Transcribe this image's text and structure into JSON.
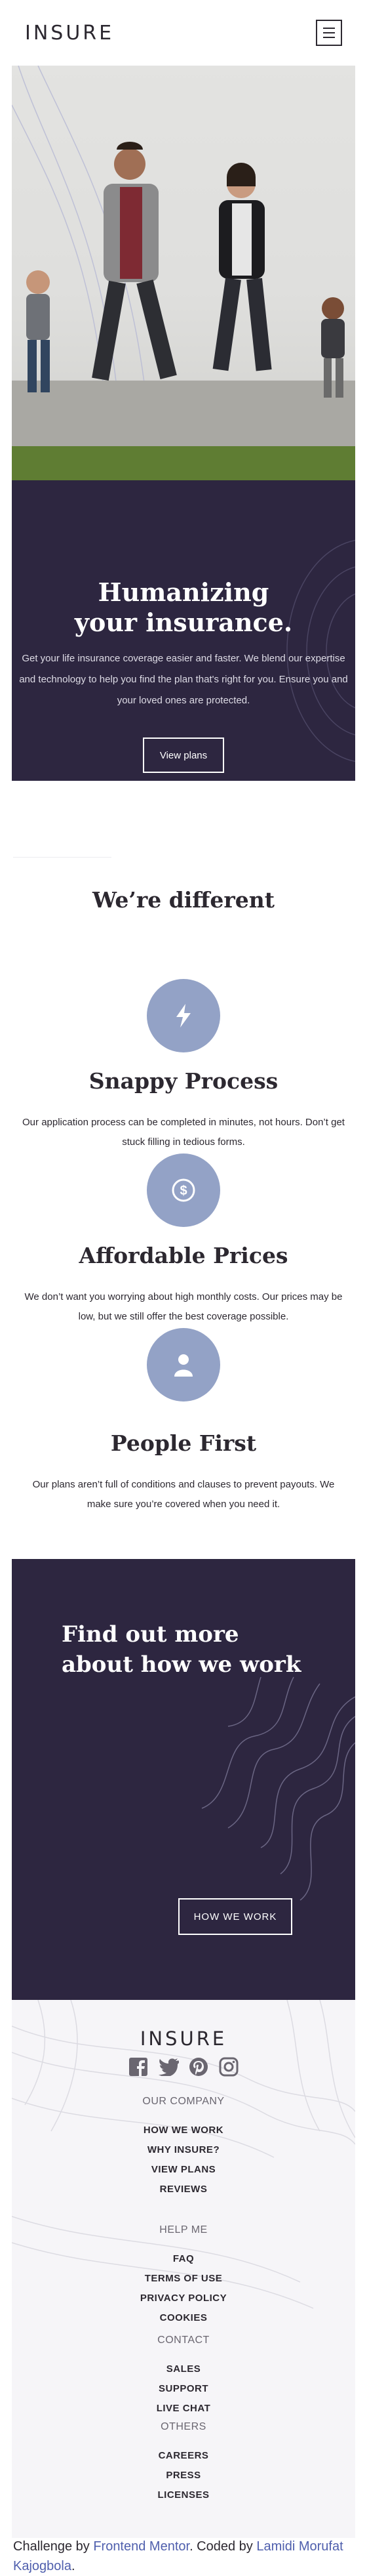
{
  "header": {
    "logo": "INSURE",
    "menu_icon": "hamburger-icon"
  },
  "hero": {
    "title_line1": "Humanizing",
    "title_line2": "your insurance.",
    "text": "Get your life insurance coverage easier and faster. We blend our expertise and technology to help you find the plan that's right for you. Ensure you and your loved ones are protected.",
    "button_label": "View plans"
  },
  "different": {
    "title": "We’re different",
    "features": [
      {
        "icon": "lightning-icon",
        "title": "Snappy Process",
        "text": "Our application process can be completed in minutes, not hours. Don’t get stuck filling in tedious forms."
      },
      {
        "icon": "dollar-coin-icon",
        "title": "Affordable Prices",
        "text": "We don’t want you worrying about high monthly costs. Our prices may be low, but we still offer the best coverage possible."
      },
      {
        "icon": "person-icon",
        "title": "People First",
        "text": "Our plans aren’t full of conditions and clauses to prevent payouts. We make sure you’re covered when you need it."
      }
    ]
  },
  "work": {
    "title_line1": "Find out more",
    "title_line2": "about how we work",
    "button_label": "HOW WE WORK"
  },
  "footer": {
    "logo": "INSURE",
    "socials": [
      "facebook-icon",
      "twitter-icon",
      "pinterest-icon",
      "instagram-icon"
    ],
    "columns": [
      {
        "heading": "OUR COMPANY",
        "links": [
          "HOW WE WORK",
          "WHY INSURE?",
          "VIEW PLANS",
          "REVIEWS"
        ]
      },
      {
        "heading": "HELP ME",
        "links": [
          "FAQ",
          "TERMS OF USE",
          "PRIVACY POLICY",
          "COOKIES"
        ]
      },
      {
        "heading": "CONTACT",
        "links": [
          "SALES",
          "SUPPORT",
          "LIVE CHAT"
        ]
      },
      {
        "heading": "OTHERS",
        "links": [
          "CAREERS",
          "PRESS",
          "LICENSES"
        ]
      }
    ]
  },
  "attribution": {
    "prefix": "Challenge by ",
    "challenge_link": "Frontend Mentor",
    "middle": ". Coded by ",
    "author_link": "Lamidi Morufat Kajogbola",
    "suffix": "."
  },
  "colors": {
    "dark_violet": "#2d2640",
    "icon_circle": "#93a2c6",
    "link_blue": "#4f5fad"
  }
}
